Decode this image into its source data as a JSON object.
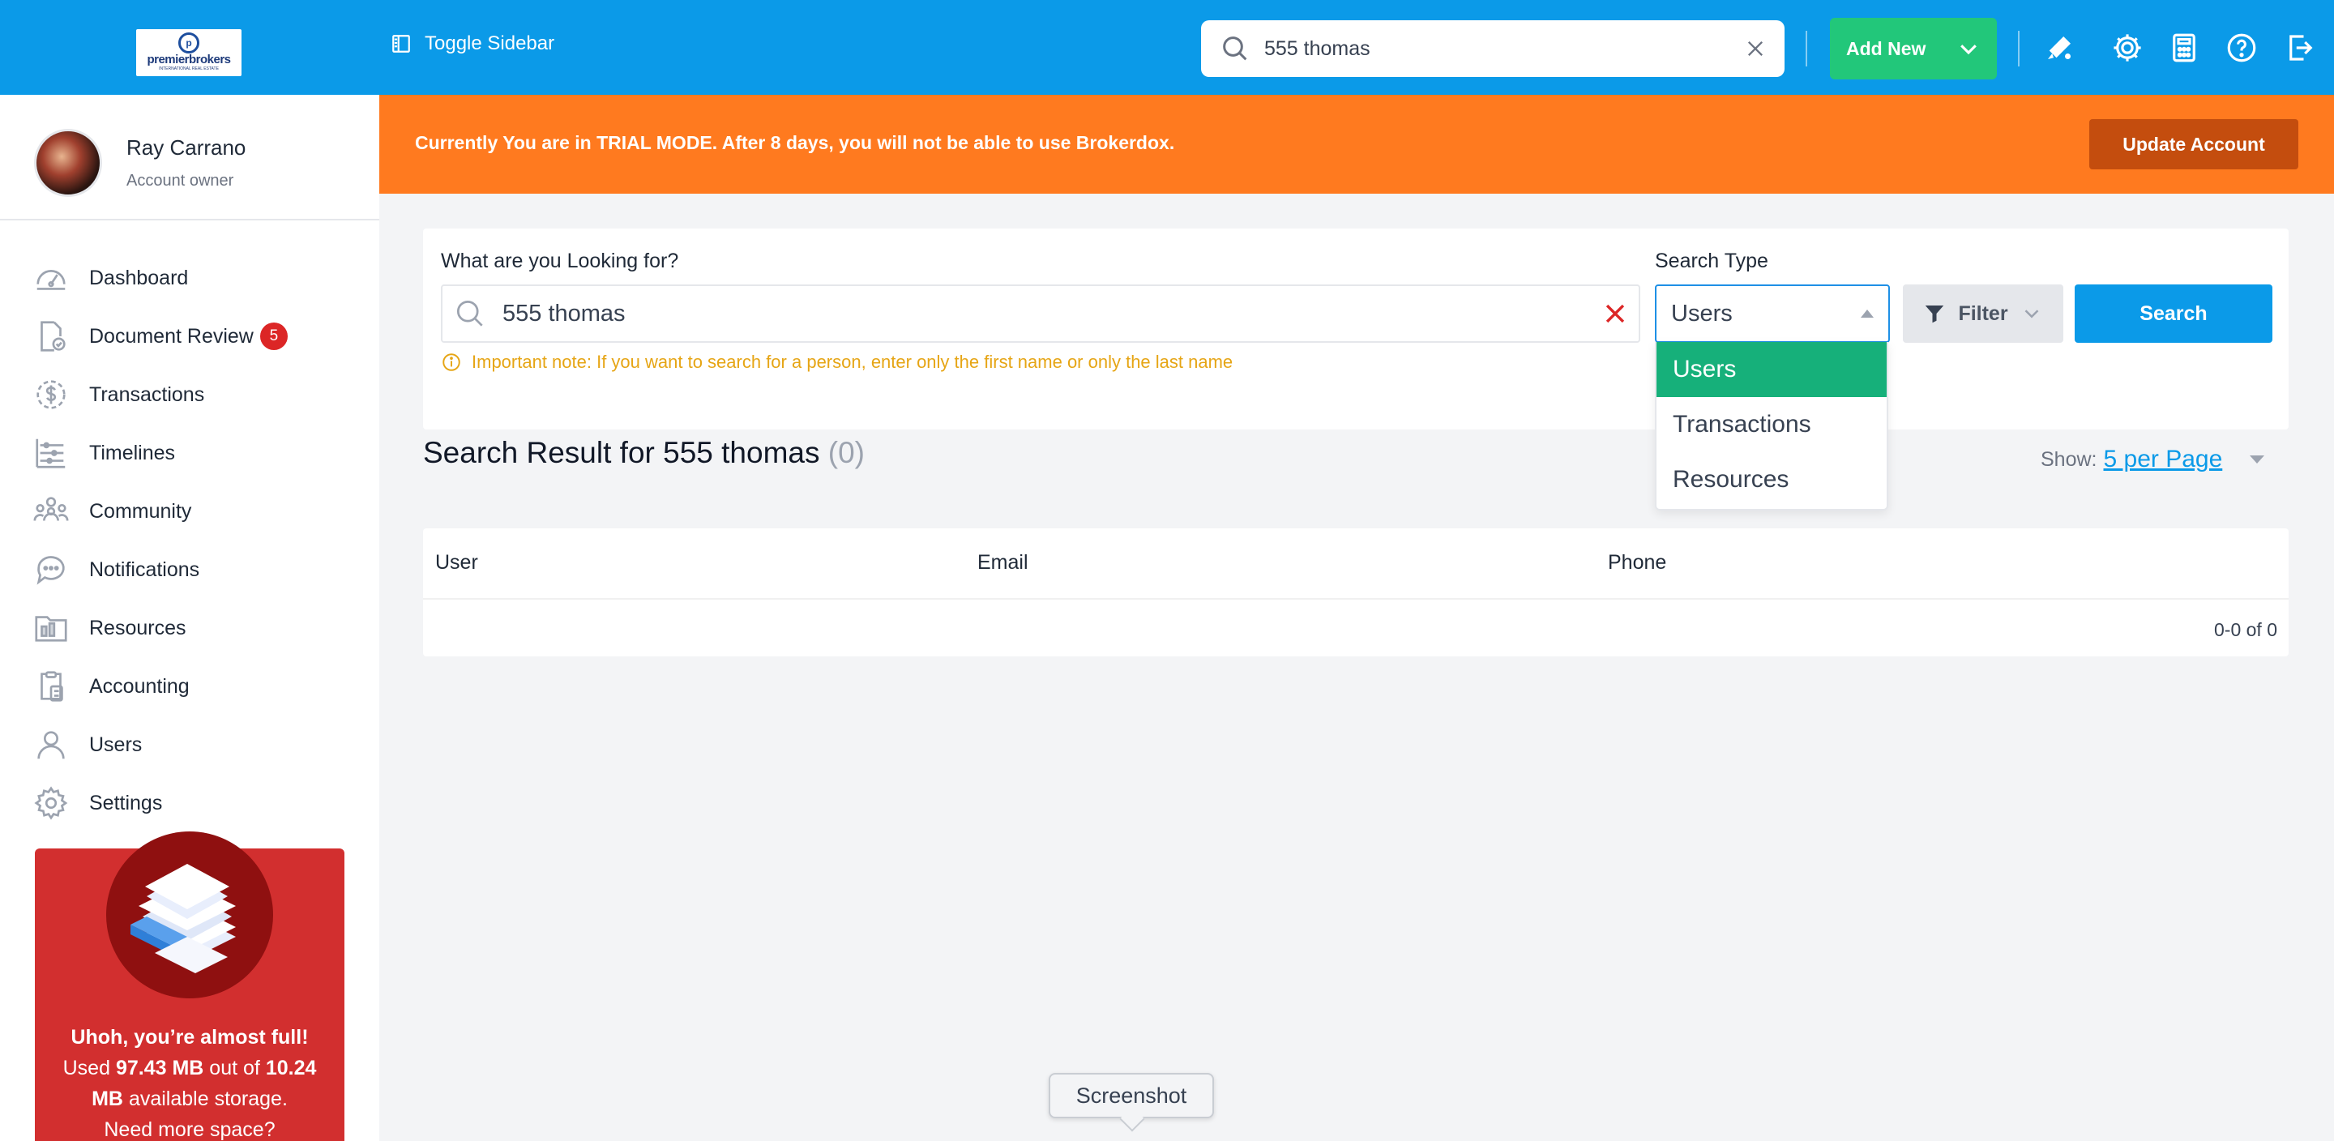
{
  "topbar": {
    "logo_text": "premierbrokers",
    "logo_sub": "INTERNATIONAL REAL ESTATE",
    "toggle_sidebar": "Toggle Sidebar",
    "search_value": "555 thomas",
    "add_new": "Add New",
    "icons": [
      "announcement-icon",
      "settings-icon",
      "calculator-icon",
      "help-icon",
      "logout-icon"
    ]
  },
  "sidebar": {
    "user_name": "Ray Carrano",
    "user_role": "Account owner",
    "items": [
      {
        "label": "Dashboard",
        "icon": "dashboard-icon"
      },
      {
        "label": "Document Review",
        "icon": "document-review-icon",
        "badge": "5"
      },
      {
        "label": "Transactions",
        "icon": "transactions-icon"
      },
      {
        "label": "Timelines",
        "icon": "timelines-icon"
      },
      {
        "label": "Community",
        "icon": "community-icon"
      },
      {
        "label": "Notifications",
        "icon": "notifications-icon"
      },
      {
        "label": "Resources",
        "icon": "resources-icon"
      },
      {
        "label": "Accounting",
        "icon": "accounting-icon"
      },
      {
        "label": "Users",
        "icon": "users-icon"
      },
      {
        "label": "Settings",
        "icon": "settings-icon"
      }
    ],
    "storage": {
      "headline": "Uhoh, you’re almost full!",
      "used_prefix": "Used",
      "used": "97.43 MB",
      "out_of": "out of",
      "available": "10.24 MB",
      "available_suffix": "available storage.",
      "more": "Need more space?"
    }
  },
  "banner": {
    "text": "Currently You are in TRIAL MODE. After 8 days, you will not be able to use Brokerdox.",
    "button": "Update Account"
  },
  "search_panel": {
    "label": "What are you Looking for?",
    "value": "555 thomas",
    "note": "Important note: If you want to search for a person, enter only the first name or only the last name",
    "type_label": "Search Type",
    "type_value": "Users",
    "type_options": [
      "Users",
      "Transactions",
      "Resources"
    ],
    "filter": "Filter",
    "search": "Search"
  },
  "results": {
    "title": "Search Result for 555 thomas",
    "count": "(0)",
    "show_label": "Show:",
    "per_page": "5 per Page",
    "columns": [
      "User",
      "Email",
      "Phone"
    ],
    "pager": "0-0 of 0"
  },
  "tooltip": "Screenshot"
}
